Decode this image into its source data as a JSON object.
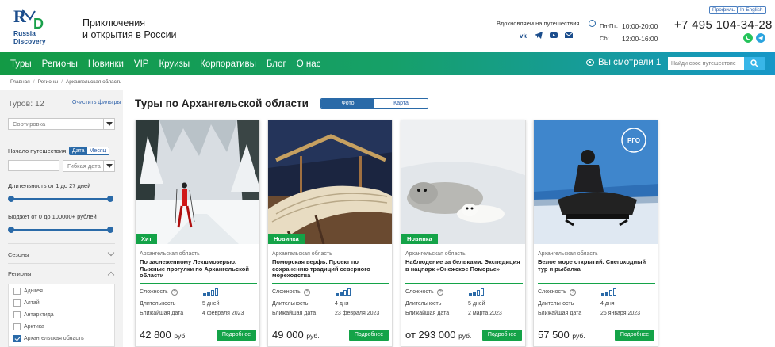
{
  "header": {
    "logo_text": "Russia Discovery",
    "tagline_line1": "Приключения",
    "tagline_line2": "и открытия в России",
    "inspire_text": "Вдохновляем на путешествия",
    "hours_weekdays_label": "Пн-Пт:",
    "hours_weekdays_time": "10:00-20:00",
    "hours_sat_label": "Сб:",
    "hours_sat_time": "12:00-16:00",
    "profile_label": "Профиль",
    "english_label": "In English",
    "phone": "+7 495 104-34-28",
    "social_icons": [
      "vk-icon",
      "telegram-icon",
      "youtube-icon",
      "mail-icon"
    ],
    "messenger_icons": [
      "whatsapp-icon",
      "telegram-icon"
    ]
  },
  "nav": {
    "items": [
      "Туры",
      "Регионы",
      "Новинки",
      "VIP",
      "Круизы",
      "Корпоративы",
      "Блог",
      "О нас"
    ],
    "viewed_label": "Вы смотрели 1",
    "search_placeholder": "Найди свое путешествие"
  },
  "breadcrumb": [
    "Главная",
    "Регионы",
    "Архангельская область"
  ],
  "sidebar": {
    "tours_count": "Туров: 12",
    "clear_filters": "Очистить фильтры",
    "sort_placeholder": "Сортировка",
    "start_label": "Начало путешествия",
    "toggle_date": "Дата",
    "toggle_month": "Месяц",
    "flexible_date": "Гибкая дата",
    "duration_label": "Длительность от 1 до 27 дней",
    "budget_label": "Бюджет от 0 до 100000+ рублей",
    "seasons_label": "Сезоны",
    "regions_label": "Регионы",
    "regions": [
      {
        "name": "Адыгея",
        "checked": false
      },
      {
        "name": "Алтай",
        "checked": false
      },
      {
        "name": "Антарктида",
        "checked": false
      },
      {
        "name": "Арктика",
        "checked": false
      },
      {
        "name": "Архангельская область",
        "checked": true
      }
    ]
  },
  "main": {
    "title": "Туры по Архангельской области",
    "view_photo": "Фото",
    "view_map": "Карта",
    "labels": {
      "difficulty": "Сложность",
      "duration": "Длительность",
      "nearest_date": "Ближайшая дата",
      "more": "Подробнее",
      "currency": "руб."
    },
    "cards": [
      {
        "badge": "Хит",
        "region": "Архангельская область",
        "title": "По заснеженному Лекшмозерью. Лыжные прогулки по Архангельской области",
        "difficulty_level": 2,
        "duration": "5 дней",
        "nearest_date": "4 февраля 2023",
        "price": "42 800"
      },
      {
        "badge": "Новинка",
        "region": "Архангельская область",
        "title": "Поморская верфь. Проект по сохранению традиций северного мореходства",
        "difficulty_level": 2,
        "duration": "4 дня",
        "nearest_date": "23 февраля 2023",
        "price": "49 000"
      },
      {
        "badge": "Новинка",
        "region": "Архангельская область",
        "title": "Наблюдение за бельками. Экспедиция в нацпарк «Онежское Поморье»",
        "difficulty_level": 2,
        "duration": "5 дней",
        "nearest_date": "2 марта 2023",
        "price": "от 293 000"
      },
      {
        "badge": "",
        "region": "Архангельская область",
        "title": "Белое море открытий. Снегоходный тур и рыбалка",
        "difficulty_level": 2,
        "duration": "4 дня",
        "nearest_date": "26 января 2023",
        "price": "57 500",
        "photo_logo_text": "РГО"
      }
    ]
  }
}
